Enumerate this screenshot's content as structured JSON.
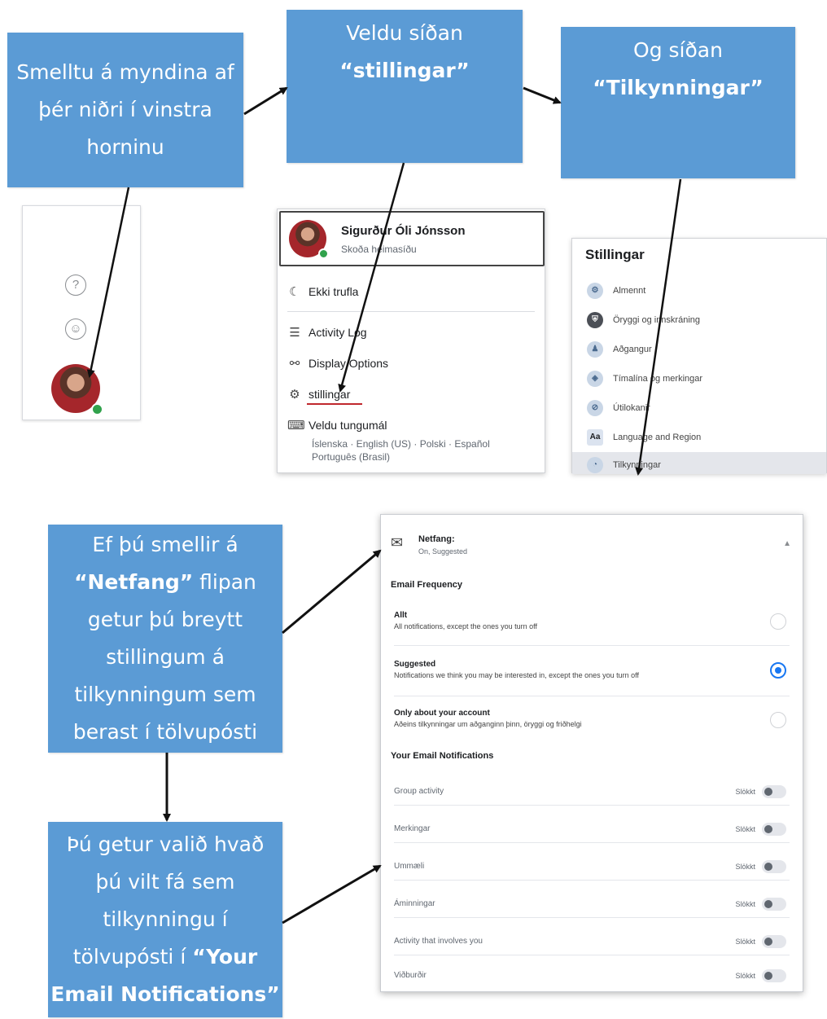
{
  "callouts": {
    "c1": [
      "Smelltu á myndina af",
      "þér niðri í vinstra",
      "horninu"
    ],
    "c2": {
      "line1": "Veldu síðan",
      "bold": "“stillingar”"
    },
    "c3": {
      "line1": "Og síðan",
      "bold": "“Tilkynningar”"
    },
    "c4": {
      "l1": "Ef þú smellir á",
      "l2_bold": "“Netfang”",
      "l2_rest": " flipan",
      "l3": "getur þú breytt",
      "l4": "stillingum á",
      "l5": "tilkynningum sem",
      "l6": "berast í tölvupósti"
    },
    "c5": {
      "l1": "Þú getur valið hvað",
      "l2": "þú vilt fá sem",
      "l3": "tilkynningu í",
      "l4_pre": "tölvupósti í ",
      "l4_bold": "“Your",
      "l5_bold": "Email Notifications”"
    }
  },
  "sidebar": {
    "help_icon": "question-circle-icon",
    "feedback_icon": "smiley-icon",
    "help_glyph": "?",
    "feedback_glyph": "☺"
  },
  "menu": {
    "profile_name": "Sigurður Óli Jónsson",
    "profile_sub": "Skoða heimasíðu",
    "items": [
      {
        "label": "Ekki trufla",
        "icon": "moon-icon",
        "glyph": "☾"
      },
      {
        "label": "Activity Log",
        "icon": "list-icon",
        "glyph": "☰"
      },
      {
        "label": "Display Options",
        "icon": "display-options-icon",
        "glyph": "⚯"
      },
      {
        "label": "stillingar",
        "icon": "gear-icon",
        "glyph": "⚙"
      },
      {
        "label": "Veldu tungumál",
        "icon": "language-icon",
        "glyph": "⌨"
      }
    ],
    "languages_line1": "Íslenska · English (US) · Polski · Español",
    "languages_line2": "Português (Brasil)"
  },
  "settings": {
    "title": "Stillingar",
    "items": [
      {
        "label": "Almennt",
        "glyph": "⚙"
      },
      {
        "label": "Öryggi og innskráning",
        "glyph": "⛨"
      },
      {
        "label": "Aðgangur",
        "glyph": "♟"
      },
      {
        "label": "Tímalína og merkingar",
        "glyph": "◈"
      },
      {
        "label": "Útilokanir",
        "glyph": "⊘"
      },
      {
        "label": "Language and Region",
        "glyph": "Aa"
      },
      {
        "label": "Tilkynningar",
        "glyph": "◔"
      }
    ]
  },
  "email": {
    "header_title": "Netfang:",
    "header_sub": "On, Suggested",
    "frequency_title": "Email Frequency",
    "options": [
      {
        "title": "Allt",
        "desc": "All notifications, except the ones you turn off",
        "selected": false
      },
      {
        "title": "Suggested",
        "desc": "Notifications we think you may be interested in, except the ones you turn off",
        "selected": true
      },
      {
        "title": "Only about your account",
        "desc": "Aðeins tilkynningar um aðganginn þinn, öryggi og friðhelgi",
        "selected": false
      }
    ],
    "notifications_title": "Your Email Notifications",
    "toggles": [
      {
        "label": "Group activity",
        "status": "Slökkt"
      },
      {
        "label": "Merkingar",
        "status": "Slökkt"
      },
      {
        "label": "Ummæli",
        "status": "Slökkt"
      },
      {
        "label": "Áminningar",
        "status": "Slökkt"
      },
      {
        "label": "Activity that involves you",
        "status": "Slökkt"
      },
      {
        "label": "Viðburðir",
        "status": "Slökkt"
      }
    ]
  }
}
